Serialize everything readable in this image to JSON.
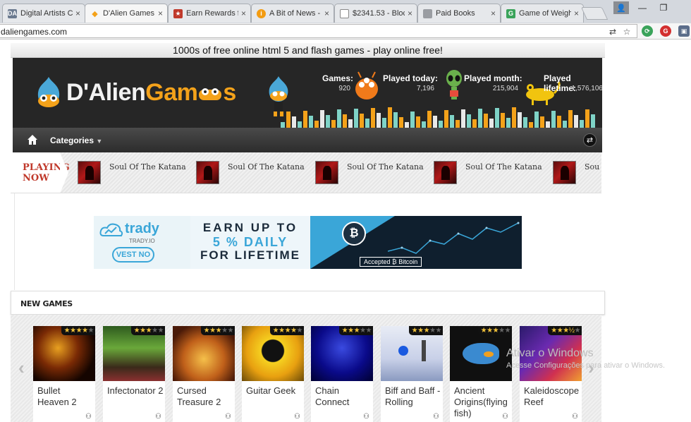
{
  "browser": {
    "tabs": [
      {
        "label": "Digital Artists C",
        "favicon": "da-icon",
        "color": "#6b7a8f",
        "glyph": "DA"
      },
      {
        "label": "D'Alien Games",
        "favicon": "gamepad-icon",
        "color": "#f4a21a",
        "glyph": "🎮"
      },
      {
        "label": "Earn Rewards f",
        "favicon": "reward-icon",
        "color": "#c0392b",
        "glyph": "★"
      },
      {
        "label": "A Bit of News -",
        "favicon": "info-icon",
        "color": "#f39c12",
        "glyph": "i"
      },
      {
        "label": "$2341.53 - Bloc",
        "favicon": "page-icon",
        "color": "#8a8d92",
        "glyph": "▯"
      },
      {
        "label": "Paid Books",
        "favicon": "books-icon",
        "color": "#8a8d92",
        "glyph": "▤"
      },
      {
        "label": "Game of Weigh",
        "favicon": "game-icon",
        "color": "#3aa35a",
        "glyph": "G"
      }
    ],
    "url": "daliengames.com"
  },
  "site": {
    "tagline": "1000s of free online html 5 and flash games - play online free!",
    "brand_white_1": "D'Alien",
    "brand_orange": "Gam",
    "brand_white_2": "s",
    "stats": {
      "games_label": "Games:",
      "games_value": "920",
      "today_label": "Played today:",
      "today_value": "7,196",
      "month_label": "Played month:",
      "month_value": "215,904",
      "lifetime_label": "Played lifetime:",
      "lifetime_value": "1,576,106"
    },
    "nav": {
      "categories": "Categories"
    },
    "playing": {
      "label_line1": "PLAYING",
      "label_line2": "NOW",
      "items": [
        "Soul Of The Katana",
        "Soul Of The Katana",
        "Soul Of The Katana",
        "Soul Of The Katana",
        "Sou"
      ]
    },
    "ad": {
      "brand": "trady",
      "brand_small": "TRADY.IO",
      "cta": "VEST NO",
      "line1": "EARN UP TO",
      "line2": "5 % DAILY",
      "line3": "FOR LIFETIME",
      "accepted": "Accepted ₿ Bitcoin"
    },
    "new_games": {
      "title": "NEW GAMES",
      "games": [
        {
          "name": "Bullet Heaven 2",
          "rating": 4
        },
        {
          "name": "Infectonator 2",
          "rating": 3
        },
        {
          "name": "Cursed Treasure 2",
          "rating": 3
        },
        {
          "name": "Guitar Geek",
          "rating": 4
        },
        {
          "name": "Chain Connect",
          "rating": 3
        },
        {
          "name": "Biff and Baff - Rolling",
          "rating": 3
        },
        {
          "name": "Ancient Origins(flying fish)",
          "rating": 3
        },
        {
          "name": "Kaleidoscope Reef",
          "rating": 3.5
        }
      ]
    }
  },
  "os": {
    "watermark_title": "Ativar o Windows",
    "watermark_sub": "Acesse Configurações para ativar o Windows."
  }
}
